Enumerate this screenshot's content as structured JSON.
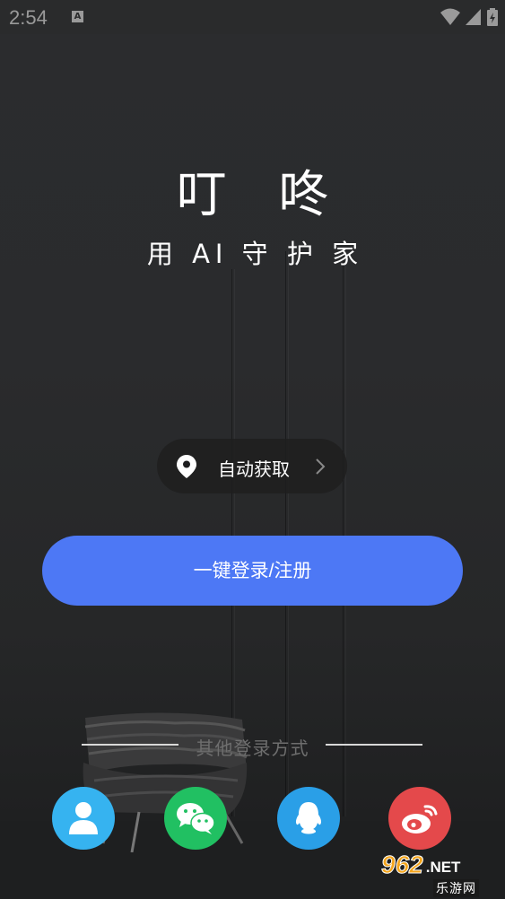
{
  "status_bar": {
    "time": "2:54",
    "notification_icon": "a-icon",
    "icons": [
      "wifi-icon",
      "signal-icon",
      "battery-icon"
    ]
  },
  "app": {
    "title": "叮 咚",
    "slogan": "用 AI 守 护 家"
  },
  "location": {
    "label": "自动获取",
    "icon": "location-pin-icon",
    "arrow_icon": "chevron-right-icon"
  },
  "login": {
    "button_label": "一键登录/注册",
    "color": "#4d78f5"
  },
  "other_login": {
    "label": "其他登录方式",
    "methods": [
      {
        "name": "account",
        "icon": "user-icon",
        "color": "#36b3f0"
      },
      {
        "name": "wechat",
        "icon": "wechat-icon",
        "color": "#21c062"
      },
      {
        "name": "qq",
        "icon": "qq-icon",
        "color": "#2a9fe7"
      },
      {
        "name": "weibo",
        "icon": "weibo-icon",
        "color": "#e4494b"
      }
    ]
  },
  "watermark": {
    "number": "962",
    "suffix": ".NET",
    "site": "乐游网"
  }
}
